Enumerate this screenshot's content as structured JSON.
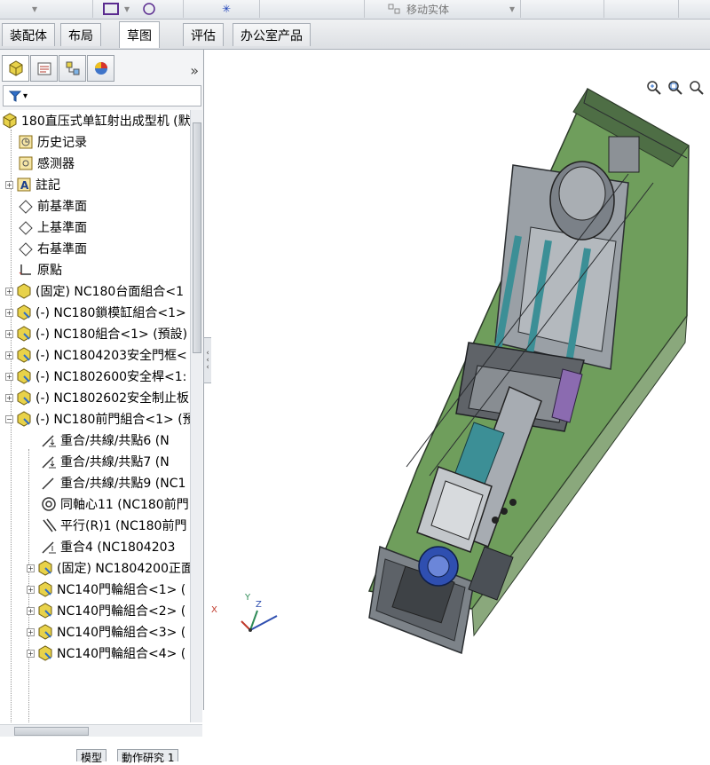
{
  "toolbar": {
    "move_entity_label": "移动实体"
  },
  "tabs": [
    {
      "label": "装配体"
    },
    {
      "label": "布局"
    },
    {
      "label": "草图"
    },
    {
      "label": "评估"
    },
    {
      "label": "办公室产品"
    }
  ],
  "panel": {
    "expand_label": "»"
  },
  "tree": {
    "root": "180直压式单缸射出成型机 (默",
    "items": [
      {
        "label": "历史记录"
      },
      {
        "label": "感测器"
      },
      {
        "label": "註記"
      },
      {
        "label": "前基準面"
      },
      {
        "label": "上基準面"
      },
      {
        "label": "右基準面"
      },
      {
        "label": "原點"
      },
      {
        "label": "(固定) NC180台面組合<1"
      },
      {
        "label": "(-) NC180鎖模缸組合<1>"
      },
      {
        "label": "(-) NC180組合<1> (預設)"
      },
      {
        "label": "(-) NC1804203安全門框<"
      },
      {
        "label": "(-) NC1802600安全桿<1:"
      },
      {
        "label": "(-) NC1802602安全制止板"
      },
      {
        "label": "(-) NC180前門組合<1> (預"
      },
      {
        "label": "重合/共線/共點6 (N"
      },
      {
        "label": "重合/共線/共點7 (N"
      },
      {
        "label": "重合/共線/共點9 (NC1"
      },
      {
        "label": "同軸心11 (NC180前門"
      },
      {
        "label": "平行(R)1 (NC180前門"
      },
      {
        "label": "重合4 (NC1804203"
      },
      {
        "label": "(固定) NC1804200正面"
      },
      {
        "label": "NC140門輪組合<1> ("
      },
      {
        "label": "NC140門輪組合<2> ("
      },
      {
        "label": "NC140門輪組合<3> ("
      },
      {
        "label": "NC140門輪組合<4> ("
      }
    ]
  },
  "bottom_tabs": [
    {
      "label": "模型"
    },
    {
      "label": "動作研究 1"
    }
  ],
  "axes": {
    "x": "X",
    "y": "Y",
    "z": "Z"
  },
  "colors": {
    "machine_green": "#6f9e5c",
    "machine_gray": "#7d8389",
    "accent_blue": "#2f6fc9"
  }
}
